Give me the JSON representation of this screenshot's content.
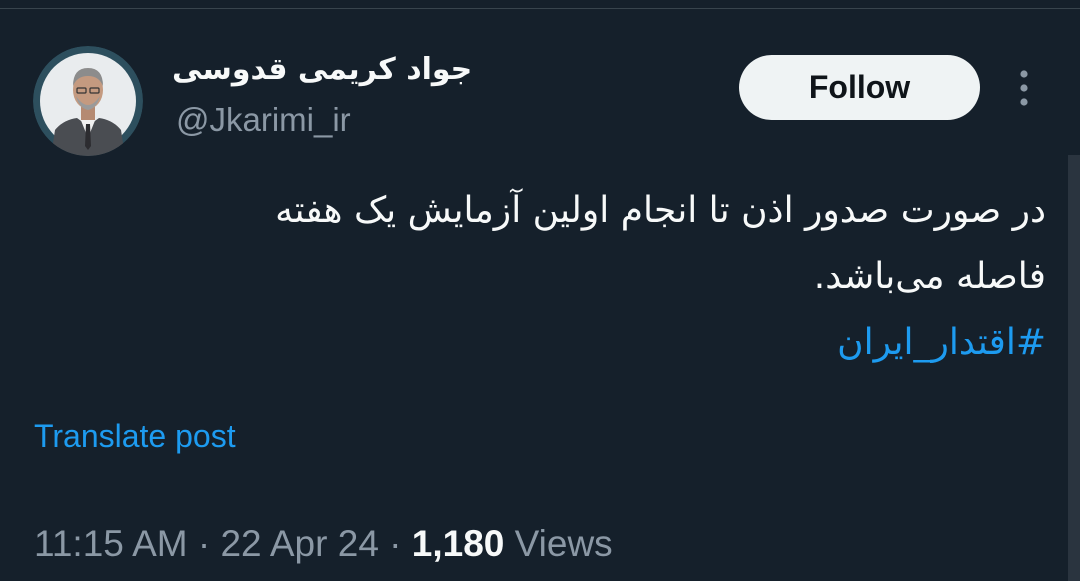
{
  "author": {
    "display_name": "جواد کریمی قدوسی",
    "handle": "@Jkarimi_ir"
  },
  "actions": {
    "follow_label": "Follow",
    "more_icon": "more-vertical-icon"
  },
  "tweet": {
    "line1": "در صورت صدور اذن تا انجام اولین آزمایش یک هفته",
    "line2": "فاصله می‌باشد.",
    "hashtag": "#اقتدار_ایران"
  },
  "translate_label": "Translate post",
  "meta": {
    "time": "11:15 AM",
    "separator": "·",
    "date": "22 Apr 24",
    "views_count": "1,180",
    "views_label": "Views"
  },
  "colors": {
    "background": "#15202b",
    "text": "#f7f9f9",
    "muted": "#8b98a5",
    "accent": "#1d9bf0",
    "button_bg": "#eff3f4"
  }
}
